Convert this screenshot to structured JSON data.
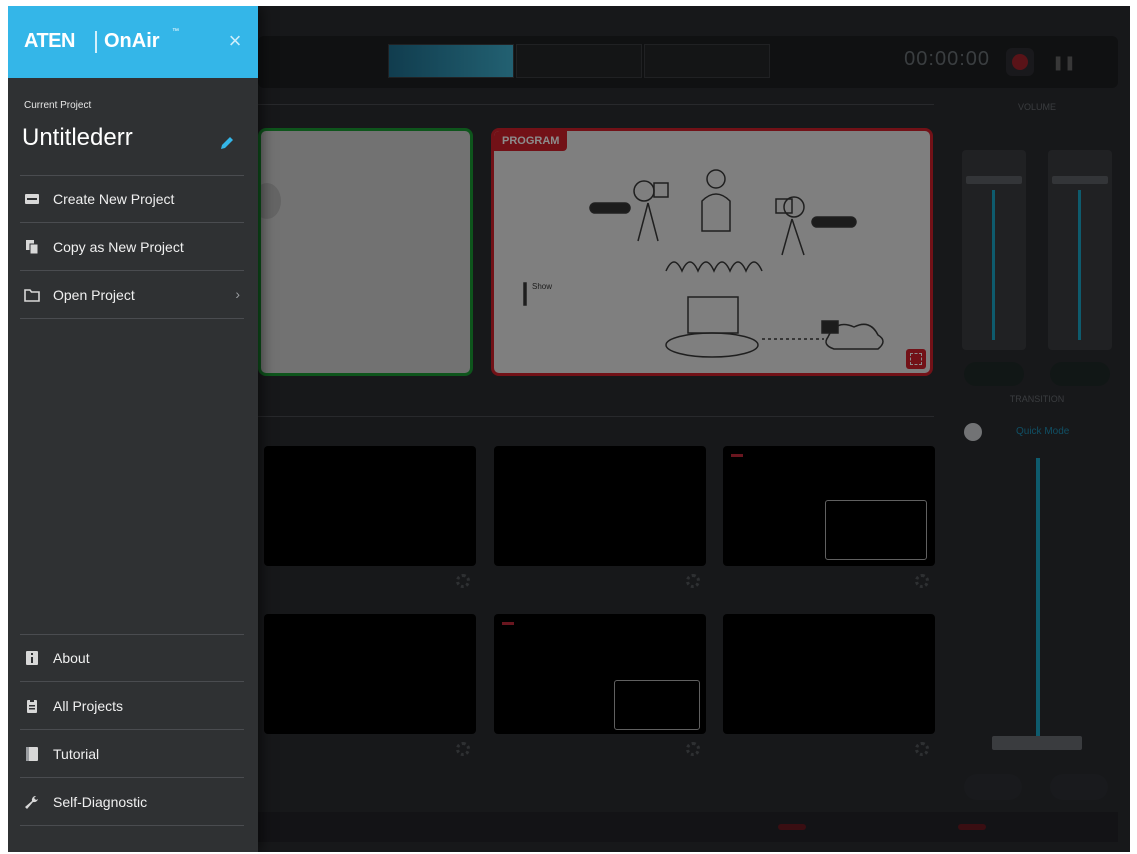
{
  "drawer": {
    "logo_brand": "ATEN",
    "logo_product": "OnAir",
    "logo_tm": "™",
    "close_symbol": "×",
    "current_project_label": "Current Project",
    "current_project_name": "Untitlederr",
    "menu_top": [
      {
        "label": "Create New Project",
        "icon": "create-project-icon"
      },
      {
        "label": "Copy as New Project",
        "icon": "copy-icon"
      },
      {
        "label": "Open Project",
        "icon": "folder-icon",
        "chevron": "›"
      }
    ],
    "menu_bottom": [
      {
        "label": "About",
        "icon": "info-icon"
      },
      {
        "label": "All Projects",
        "icon": "clipboard-icon"
      },
      {
        "label": "Tutorial",
        "icon": "book-icon"
      },
      {
        "label": "Self-Diagnostic",
        "icon": "wrench-icon"
      }
    ]
  },
  "background_app": {
    "tabs": [
      "",
      "",
      ""
    ],
    "timecode": "00:00:00",
    "program_label": "PROGRAM",
    "volume_title": "VOLUME",
    "transition_title": "TRANSITION",
    "quick_mode_label": "Quick Mode",
    "colors": {
      "accent": "#34b6e8",
      "preview_border": "#1b9b33",
      "program_border": "#d0202a",
      "drawer_bg": "#2f3133"
    }
  }
}
